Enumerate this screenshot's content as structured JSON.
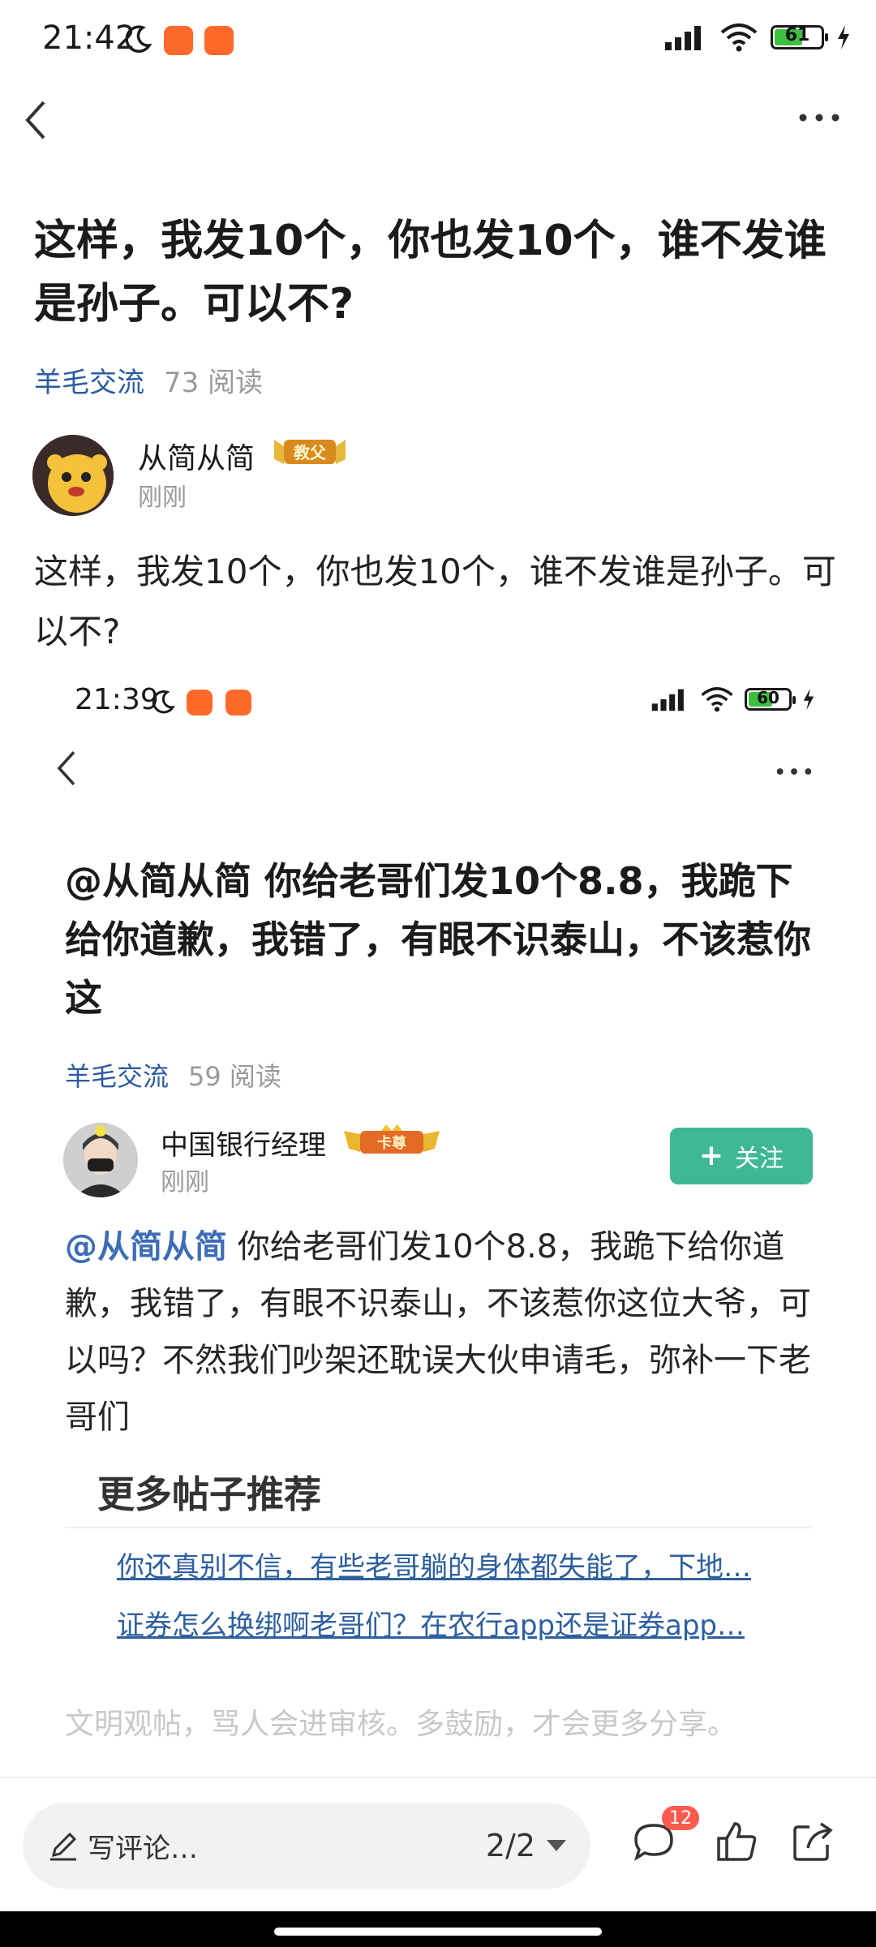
{
  "status_bar": {
    "time": "21:42",
    "battery": "61",
    "battery_level": 0.61
  },
  "post": {
    "title": "这样，我发10个，你也发10个，谁不发谁是孙子。可以不?",
    "category": "羊毛交流",
    "reads": "73 阅读",
    "author": {
      "name": "从简从简",
      "badge": "教父",
      "time": "刚刚"
    },
    "body": "这样，我发10个，你也发10个，谁不发谁是孙子。可以不?"
  },
  "embedded_screenshot": {
    "status_bar": {
      "time": "21:39",
      "battery": "60",
      "battery_level": 0.6
    },
    "title": "@从简从简 你给老哥们发10个8.8，我跪下给你道歉，我错了，有眼不识泰山，不该惹你这",
    "category": "羊毛交流",
    "reads": "59 阅读",
    "author": {
      "name": "中国银行经理",
      "badge": "卡尊",
      "time": "刚刚"
    },
    "follow_label": "关注",
    "follow_icon": "plus-icon",
    "body_mention": "@从简从简",
    "body_text": " 你给老哥们发10个8.8，我跪下给你道歉，我错了，有眼不识泰山，不该惹你这位大爷，可以吗？不然我们吵架还耽误大伙申请毛，弥补一下老哥们",
    "more_posts_heading": "更多帖子推荐",
    "recommendations": [
      "你还真别不信，有些老哥躺的身体都失能了，下地…",
      "证券怎么换绑啊老哥们？在农行app还是证券app…"
    ],
    "footer_note": "文明观帖，骂人会进审核。多鼓励，才会更多分享。"
  },
  "bottom_bar": {
    "comment_placeholder": "写评论…",
    "page_indicator": "2/2",
    "comment_count": "12",
    "icons": [
      "pencil-icon",
      "comment-icon",
      "like-icon",
      "share-icon"
    ]
  },
  "colors": {
    "accent_green": "#3fb896",
    "link_blue": "#2b5aa0",
    "badge_red": "#ff5a4f"
  }
}
